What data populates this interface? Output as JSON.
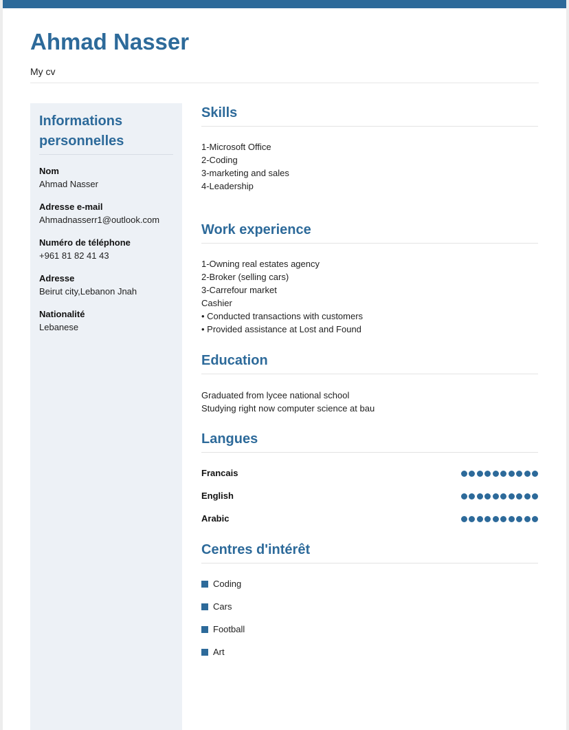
{
  "header": {
    "name": "Ahmad Nasser",
    "subtitle": "My cv",
    "accent_color": "#2d6a9a"
  },
  "sidebar": {
    "title": "Informations personnelles",
    "fields": [
      {
        "label": "Nom",
        "value": "Ahmad Nasser"
      },
      {
        "label": "Adresse e-mail",
        "value": "Ahmadnasserr1@outlook.com"
      },
      {
        "label": "Numéro de téléphone",
        "value": "+961 81 82 41 43"
      },
      {
        "label": "Adresse",
        "value": "Beirut city,Lebanon Jnah"
      },
      {
        "label": "Nationalité",
        "value": "Lebanese"
      }
    ]
  },
  "skills": {
    "title": "Skills",
    "items": [
      "1-Microsoft Office",
      "2-Coding",
      "3-marketing and sales",
      "4-Leadership"
    ]
  },
  "work": {
    "title": "Work experience",
    "items": [
      "1-Owning real estates agency",
      "2-Broker (selling cars)",
      "3-Carrefour market",
      "Cashier",
      "• Conducted transactions with customers",
      "• Provided assistance at Lost and Found"
    ]
  },
  "education": {
    "title": "Education",
    "items": [
      "Graduated from lycee national school",
      "Studying right now computer science at bau"
    ]
  },
  "languages": {
    "title": "Langues",
    "items": [
      {
        "name": "Francais",
        "level": 10,
        "max": 10
      },
      {
        "name": "English",
        "level": 10,
        "max": 10
      },
      {
        "name": "Arabic",
        "level": 10,
        "max": 10
      }
    ]
  },
  "interests": {
    "title": "Centres d'intérêt",
    "items": [
      "Coding",
      "Cars",
      "Football",
      "Art"
    ]
  }
}
